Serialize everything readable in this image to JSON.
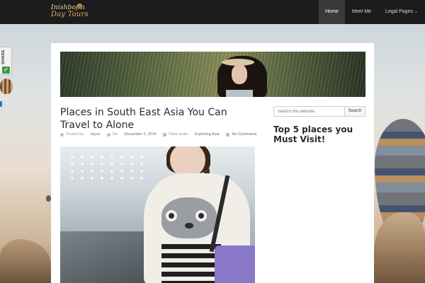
{
  "header": {
    "logo_line1": "Inishbofin",
    "logo_line2": "Day Tours",
    "nav": [
      {
        "label": "Home",
        "active": true
      },
      {
        "label": "Meet Me",
        "active": false
      },
      {
        "label": "Legal Pages",
        "active": false,
        "has_dropdown": true
      }
    ]
  },
  "share_widget": {
    "label": "SHARE",
    "check_icon": "✓"
  },
  "post": {
    "title": "Places in South East Asia You Can Travel to Alone",
    "meta": {
      "posted_by_label": "Posted by",
      "author": "Joyce",
      "on_label": "On",
      "date": "December 3, 2014",
      "filed_label": "Filed under",
      "category": "Exploring Asia",
      "comments": "No Comments"
    }
  },
  "sidebar": {
    "search_placeholder": "Search this website",
    "search_button": "Search",
    "widget_title": "Top 5 places you Must Visit!"
  },
  "colors": {
    "header_bg": "#1c1c1c",
    "nav_active_bg": "#3a3a3a",
    "link": "#5a6d8a"
  }
}
